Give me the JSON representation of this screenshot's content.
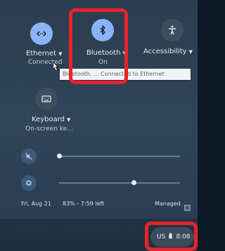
{
  "tiles": {
    "ethernet": {
      "label": "Ethernet",
      "sublabel": "Connected",
      "icon": "ethernet-icon",
      "state": "on"
    },
    "bluetooth": {
      "label": "Bluetooth",
      "sublabel": "On",
      "icon": "bluetooth-icon",
      "state": "on"
    },
    "accessibility": {
      "label": "Accessibility",
      "icon": "accessibility-icon",
      "state": "off"
    },
    "keyboard": {
      "label": "Keyboard",
      "sublabel": "On-screen ke...",
      "icon": "keyboard-icon",
      "state": "off"
    }
  },
  "tooltip": {
    "text": "Bluetooth, ... Connected to Ethernet"
  },
  "sliders": {
    "volume": {
      "icon": "volume-muted-icon",
      "level": 0.0
    },
    "brightness": {
      "icon": "brightness-icon",
      "level": 0.62
    }
  },
  "status": {
    "date": "Fri, Aug 21",
    "battery": "83% - 7:59 left",
    "managed": "Managed"
  },
  "tray": {
    "locale": "US",
    "time": "8:08"
  },
  "colors": {
    "accent": "#8ab4f8",
    "highlight": "#e8232b"
  }
}
